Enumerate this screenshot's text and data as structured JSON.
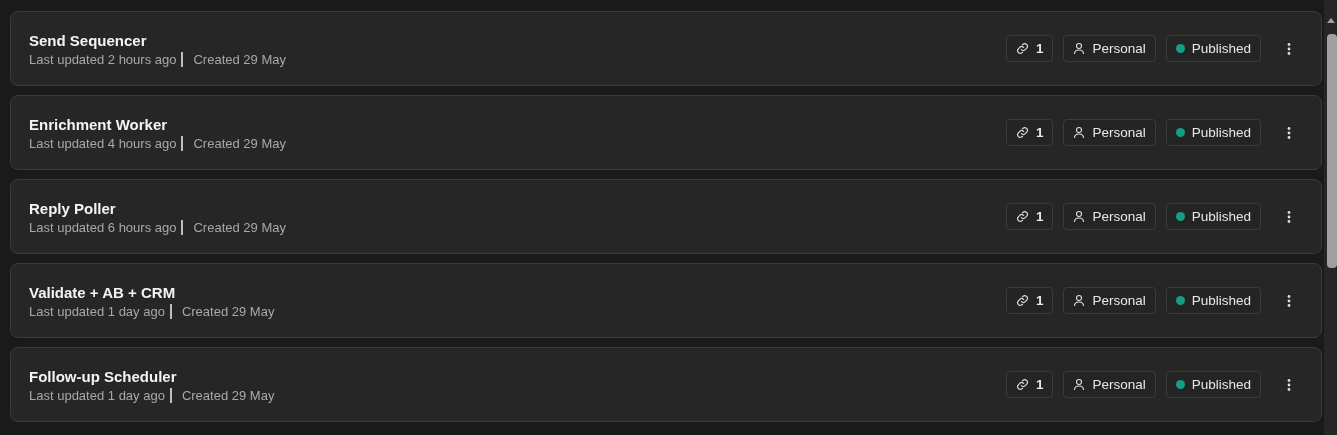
{
  "workflows": [
    {
      "name": "Send Sequencer",
      "updated": "Last updated 2 hours ago",
      "created": "Created 29 May",
      "links": "1",
      "owner": "Personal",
      "status": "Published"
    },
    {
      "name": "Enrichment Worker",
      "updated": "Last updated 4 hours ago",
      "created": "Created 29 May",
      "links": "1",
      "owner": "Personal",
      "status": "Published"
    },
    {
      "name": "Reply Poller",
      "updated": "Last updated 6 hours ago",
      "created": "Created 29 May",
      "links": "1",
      "owner": "Personal",
      "status": "Published"
    },
    {
      "name": "Validate + AB + CRM",
      "updated": "Last updated 1 day ago",
      "created": "Created 29 May",
      "links": "1",
      "owner": "Personal",
      "status": "Published"
    },
    {
      "name": "Follow-up Scheduler",
      "updated": "Last updated 1 day ago",
      "created": "Created 29 May",
      "links": "1",
      "owner": "Personal",
      "status": "Published"
    }
  ]
}
